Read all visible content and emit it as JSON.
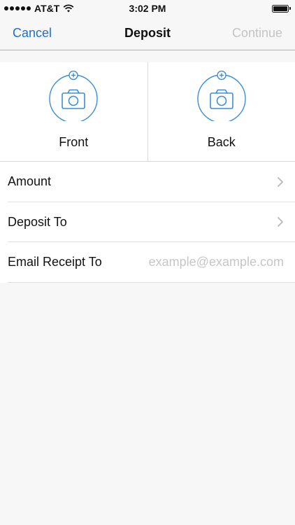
{
  "status_bar": {
    "carrier": "AT&T",
    "time": "3:02 PM",
    "icons": [
      "signal-dots-icon",
      "wifi-icon",
      "battery-icon"
    ]
  },
  "nav": {
    "cancel_label": "Cancel",
    "title": "Deposit",
    "continue_label": "Continue"
  },
  "photos": {
    "front_label": "Front",
    "back_label": "Back",
    "icon": "camera-add-icon"
  },
  "form": {
    "amount_label": "Amount",
    "deposit_to_label": "Deposit To",
    "email_label": "Email Receipt To",
    "email_placeholder": "example@example.com",
    "email_value": ""
  },
  "colors": {
    "accent": "#1f6fd1",
    "disabled": "#c4c4c4",
    "background": "#f7f7f7",
    "icon_blue": "#3b8ed6"
  }
}
